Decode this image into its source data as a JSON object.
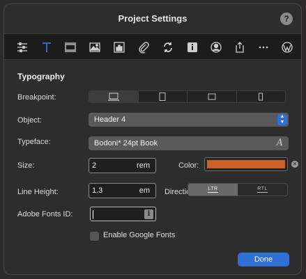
{
  "window": {
    "title": "Project Settings",
    "help_label": "?"
  },
  "toolbar": {
    "items": [
      {
        "name": "sliders-icon"
      },
      {
        "name": "typography-icon",
        "active": true
      },
      {
        "name": "layout-icon"
      },
      {
        "name": "image-icon"
      },
      {
        "name": "chart-icon"
      },
      {
        "name": "paperclip-icon"
      },
      {
        "name": "sync-icon"
      },
      {
        "name": "info-icon"
      },
      {
        "name": "user-icon"
      },
      {
        "name": "share-icon"
      },
      {
        "name": "more-icon"
      },
      {
        "name": "wordpress-icon"
      }
    ],
    "active_color": "#3b82f6"
  },
  "typography": {
    "section_title": "Typography",
    "breakpoint_label": "Breakpoint:",
    "object_label": "Object:",
    "object_value": "Header 4",
    "typeface_label": "Typeface:",
    "typeface_value": "Bodoni* 24pt Book",
    "typeface_icon": "A",
    "size_label": "Size:",
    "size_value": "2",
    "size_unit": "rem",
    "color_label": "Color:",
    "color_value": "#c8622a",
    "clear_label": "×",
    "line_height_label": "Line Height:",
    "line_height_value": "1.3",
    "line_height_unit": "em",
    "direction_label": "Direction:",
    "direction_options": [
      "LTR",
      "RTL"
    ],
    "direction_selected": "LTR",
    "adobe_label": "Adobe Fonts ID:",
    "adobe_value": "",
    "adobe_info_icon": "i",
    "google_fonts_label": "Enable Google Fonts",
    "google_fonts_checked": false,
    "stepper_up": "▲",
    "stepper_down": "▼"
  },
  "footer": {
    "done_label": "Done"
  }
}
